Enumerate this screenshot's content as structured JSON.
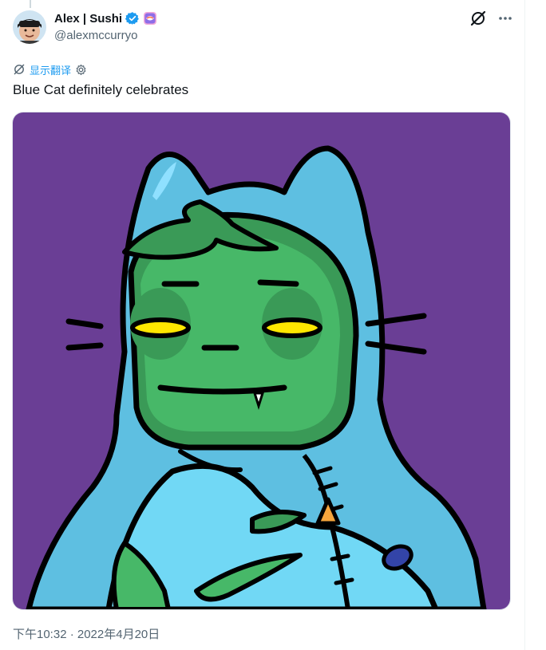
{
  "tweet": {
    "author": {
      "display_name": "Alex | Sushi",
      "handle": "@alexmccurryo",
      "verified_badge": "verified-badge-icon",
      "extra_badge": "sushi-emoji-icon"
    },
    "translate_label": "显示翻译",
    "text": "Blue Cat definitely celebrates",
    "timestamp": "下午10:32 · 2022年4月20日",
    "media": {
      "description_icon": "blue-cat-hoodie-artwork",
      "background_color": "#6a3e95"
    }
  },
  "colors": {
    "accent": "#1d9bf0",
    "text_primary": "#0f1419",
    "text_secondary": "#536471"
  }
}
